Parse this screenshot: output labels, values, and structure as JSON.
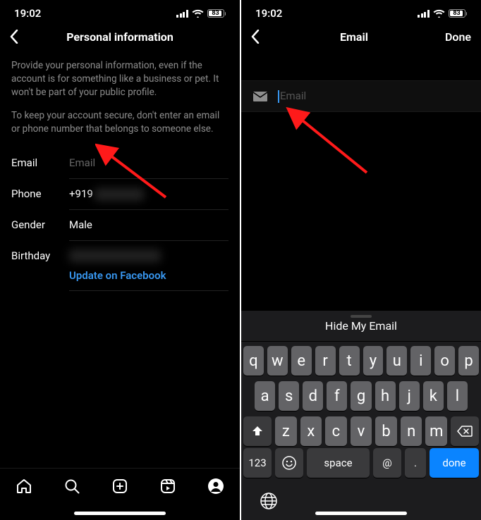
{
  "status": {
    "time": "19:02",
    "battery_pct": "83"
  },
  "left": {
    "title": "Personal information",
    "blurb1": "Provide your personal information, even if the account is for something like a business or pet. It won't be part of your public profile.",
    "blurb2": "To keep your account secure, don't enter an email or phone number that belongs to someone else.",
    "rows": {
      "email_label": "Email",
      "email_placeholder": "Email",
      "phone_label": "Phone",
      "phone_value": "+919",
      "gender_label": "Gender",
      "gender_value": "Male",
      "birthday_label": "Birthday",
      "update_link": "Update on Facebook"
    }
  },
  "right": {
    "title": "Email",
    "done_label": "Done",
    "email_placeholder": "Email",
    "keyboard": {
      "suggestion": "Hide My Email",
      "row1": [
        "q",
        "w",
        "e",
        "r",
        "t",
        "y",
        "u",
        "i",
        "o",
        "p"
      ],
      "row2": [
        "a",
        "s",
        "d",
        "f",
        "g",
        "h",
        "j",
        "k",
        "l"
      ],
      "row3": [
        "z",
        "x",
        "c",
        "v",
        "b",
        "n",
        "m"
      ],
      "num_key": "123",
      "space_key": "space",
      "at_key": "@",
      "dot_key": ".",
      "done_key": "done"
    }
  }
}
